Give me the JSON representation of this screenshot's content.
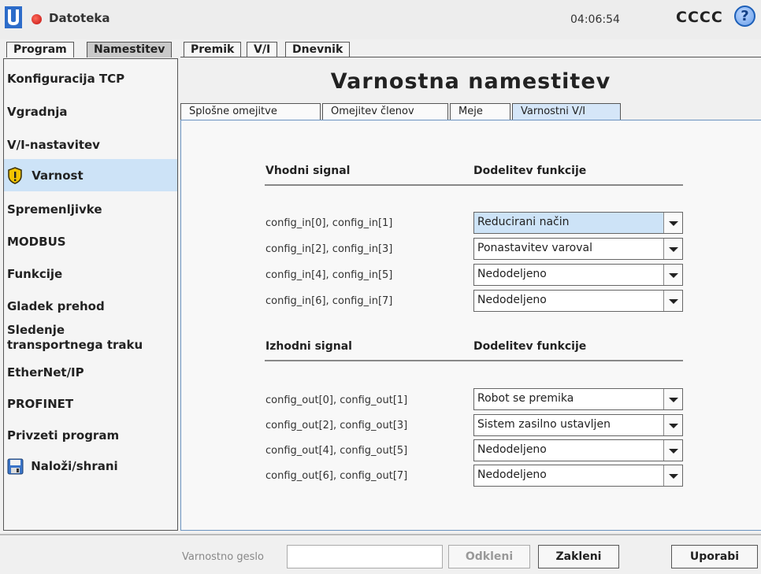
{
  "header": {
    "app_menu": "Datoteka",
    "clock": "04:06:54",
    "robot_name": "CCCC",
    "help_glyph": "?"
  },
  "main_tabs": [
    {
      "label": "Program",
      "active": false
    },
    {
      "label": "Namestitev",
      "active": true
    },
    {
      "label": "Premik",
      "active": false
    },
    {
      "label": "V/I",
      "active": false
    },
    {
      "label": "Dnevnik",
      "active": false
    }
  ],
  "sidebar": {
    "items": [
      {
        "label": "Konfiguracija TCP"
      },
      {
        "label": "Vgradnja"
      },
      {
        "label": "V/I-nastavitev"
      },
      {
        "label": "Varnost",
        "icon": "warning-shield-icon",
        "active": true
      },
      {
        "label": "Spremenljivke"
      },
      {
        "label": "MODBUS"
      },
      {
        "label": "Funkcije"
      },
      {
        "label": "Gladek prehod"
      },
      {
        "label": "Sledenje transportnega traku"
      },
      {
        "label": "EtherNet/IP"
      },
      {
        "label": "PROFINET"
      },
      {
        "label": "Privzeti program"
      },
      {
        "label": "Naloži/shrani",
        "icon": "floppy-disk-icon"
      }
    ]
  },
  "main": {
    "title": "Varnostna namestitev",
    "sub_tabs": [
      {
        "label": "Splošne omejitve",
        "active": false
      },
      {
        "label": "Omejitev členov",
        "active": false
      },
      {
        "label": "Meje",
        "active": false
      },
      {
        "label": "Varnostni V/I",
        "active": true
      }
    ],
    "inputs": {
      "col_signal": "Vhodni signal",
      "col_function": "Dodelitev funkcije",
      "rows": [
        {
          "signal": "config_in[0], config_in[1]",
          "function": "Reducirani način"
        },
        {
          "signal": "config_in[2], config_in[3]",
          "function": "Ponastavitev varoval"
        },
        {
          "signal": "config_in[4], config_in[5]",
          "function": "Nedodeljeno"
        },
        {
          "signal": "config_in[6], config_in[7]",
          "function": "Nedodeljeno"
        }
      ]
    },
    "outputs": {
      "col_signal": "Izhodni signal",
      "col_function": "Dodelitev funkcije",
      "rows": [
        {
          "signal": "config_out[0], config_out[1]",
          "function": "Robot se premika"
        },
        {
          "signal": "config_out[2], config_out[3]",
          "function": "Sistem zasilno ustavljen"
        },
        {
          "signal": "config_out[4], config_out[5]",
          "function": "Nedodeljeno"
        },
        {
          "signal": "config_out[6], config_out[7]",
          "function": "Nedodeljeno"
        }
      ]
    }
  },
  "footer": {
    "password_label": "Varnostno geslo",
    "password_value": "",
    "unlock_label": "Odkleni",
    "lock_label": "Zakleni",
    "apply_label": "Uporabi"
  },
  "colors": {
    "selected_bg": "#cde3f7",
    "panel_border": "#6b93c0",
    "status_dot": "#d42020",
    "help_blue": "#1d5fb8"
  }
}
